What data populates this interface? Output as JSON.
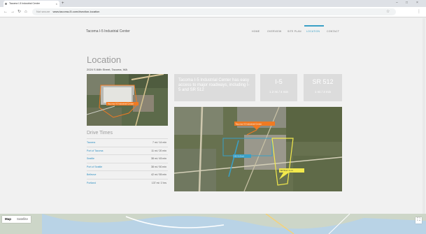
{
  "browser": {
    "tab_title": "Tacoma I-5 Industrial Center",
    "tab_close": "×",
    "new_tab": "+",
    "back": "←",
    "forward": "→",
    "reload": "↻",
    "home": "⌂",
    "security_label": "Not secure",
    "url": "www.tacoma-i5.com/#section-location",
    "star": "☆",
    "menu": "⋮",
    "win_min": "–",
    "win_max": "□",
    "win_close": "×"
  },
  "site": {
    "name": "Tacoma I-5 Industrial Center",
    "nav": [
      {
        "label": "HOME"
      },
      {
        "label": "OVERVIEW"
      },
      {
        "label": "SITE PLAN"
      },
      {
        "label": "LOCATION"
      },
      {
        "label": "CONTACT"
      }
    ]
  },
  "location": {
    "title": "Location",
    "address": "2024 S 84th Street, Tacoma, WA",
    "description": "Tacoma I-5 Industrial Center has easy access to major roadways, including I-5 and SR 512",
    "stats": [
      {
        "road": "I-5",
        "distance": "1.2 mi / 4 min"
      },
      {
        "road": "SR 512",
        "distance": "1 mi / 3 min"
      }
    ],
    "small_map_label": "Tacoma I-5 Industrial Center",
    "big_map_labels": {
      "site": "Tacoma I-5 Industrial Center",
      "i5": "I-5 / 1.2 mi",
      "sr512": "SR 512 / 1 mi"
    }
  },
  "drive_times": {
    "title": "Drive Times",
    "rows": [
      {
        "destination": "Tacoma",
        "time": "7 mi / 14 min"
      },
      {
        "destination": "Port of Tacoma",
        "time": "11 mi / 20 min"
      },
      {
        "destination": "Seattle",
        "time": "38 mi / 45 min"
      },
      {
        "destination": "Port of Seattle",
        "time": "38 mi / 50 min"
      },
      {
        "destination": "Bellevue",
        "time": "42 mi / 55 min"
      },
      {
        "destination": "Portland",
        "time": "137 mi / 2 hrs"
      }
    ]
  },
  "bottom_map": {
    "map_label": "Map",
    "satellite_label": "Satellite",
    "fullscreen": "⛶"
  },
  "colors": {
    "accent": "#3aa0c6",
    "site_marker": "#f07a22",
    "sr512_marker": "#f2e94c",
    "i5_marker": "#3aa0c6",
    "panel": "#dcdcdc"
  }
}
